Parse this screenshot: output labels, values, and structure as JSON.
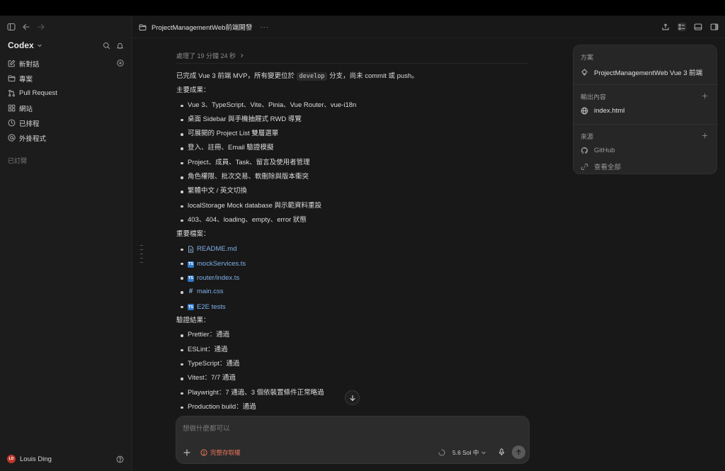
{
  "sidebar": {
    "brand": "Codex",
    "nav": [
      {
        "label": "新對話",
        "icon": "edit-icon"
      },
      {
        "label": "專案",
        "icon": "folder-icon"
      },
      {
        "label": "Pull Request",
        "icon": "pull-request-icon"
      },
      {
        "label": "網站",
        "icon": "grid-icon"
      },
      {
        "label": "已排程",
        "icon": "clock-icon"
      },
      {
        "label": "外掛程式",
        "icon": "at-icon"
      }
    ],
    "subscribed": "已訂閱",
    "user": {
      "name": "Louis Ding",
      "initials": "LD",
      "avatar_color": "#c0392b"
    }
  },
  "toolbar": {
    "title": "ProjectManagementWeb前端開發",
    "more": "···"
  },
  "conversation": {
    "processed": "處理了 19 分鐘 24 秒",
    "summary_pre": "已完成 Vue 3 前端 MVP，所有變更位於",
    "summary_code": "develop",
    "summary_post": "分支，尚未 commit 或 push。",
    "outcomes_heading": "主要成果：",
    "outcomes": [
      "Vue 3、TypeScript、Vite、Pinia、Vue Router、vue-i18n",
      "桌面 Sidebar 與手機抽屜式 RWD 導覽",
      "可展開的 Project List 雙層選單",
      "登入、註冊、Email 驗證模擬",
      "Project、成員、Task、留言及使用者管理",
      "角色權限、批次交易、軟刪除與版本衝突",
      "繁體中文 / 英文切換",
      "localStorage Mock database 與示範資料重設",
      "403、404、loading、empty、error 狀態"
    ],
    "files_heading": "重要檔案：",
    "files": [
      {
        "name": "README.md",
        "icon": "document-icon"
      },
      {
        "name": "mockServices.ts",
        "icon": "typescript-icon"
      },
      {
        "name": "router/index.ts",
        "icon": "typescript-icon"
      },
      {
        "name": "main.css",
        "icon": "hash-icon"
      },
      {
        "name": "E2E tests",
        "icon": "typescript-icon"
      }
    ],
    "ts_badge": "TS",
    "verify_heading": "驗證結果：",
    "verify": [
      "Prettier：通過",
      "ESLint：通過",
      "TypeScript：通過",
      "Vitest：7/7 通過",
      "Playwright：7 通過、3 個依裝置條件正常略過",
      "Production build：通過"
    ]
  },
  "composer": {
    "placeholder": "想做什麼都可以",
    "access_label": "完整存取權",
    "model_label": "5.6 Sol 中",
    "accent_color": "#e8745a"
  },
  "panel": {
    "plan_heading": "方案",
    "plan_item": "ProjectManagementWeb Vue 3 前端",
    "output_heading": "輸出內容",
    "output_item": "index.html",
    "sources_heading": "來源",
    "sources_item": "GitHub",
    "view_all": "查看全部"
  }
}
